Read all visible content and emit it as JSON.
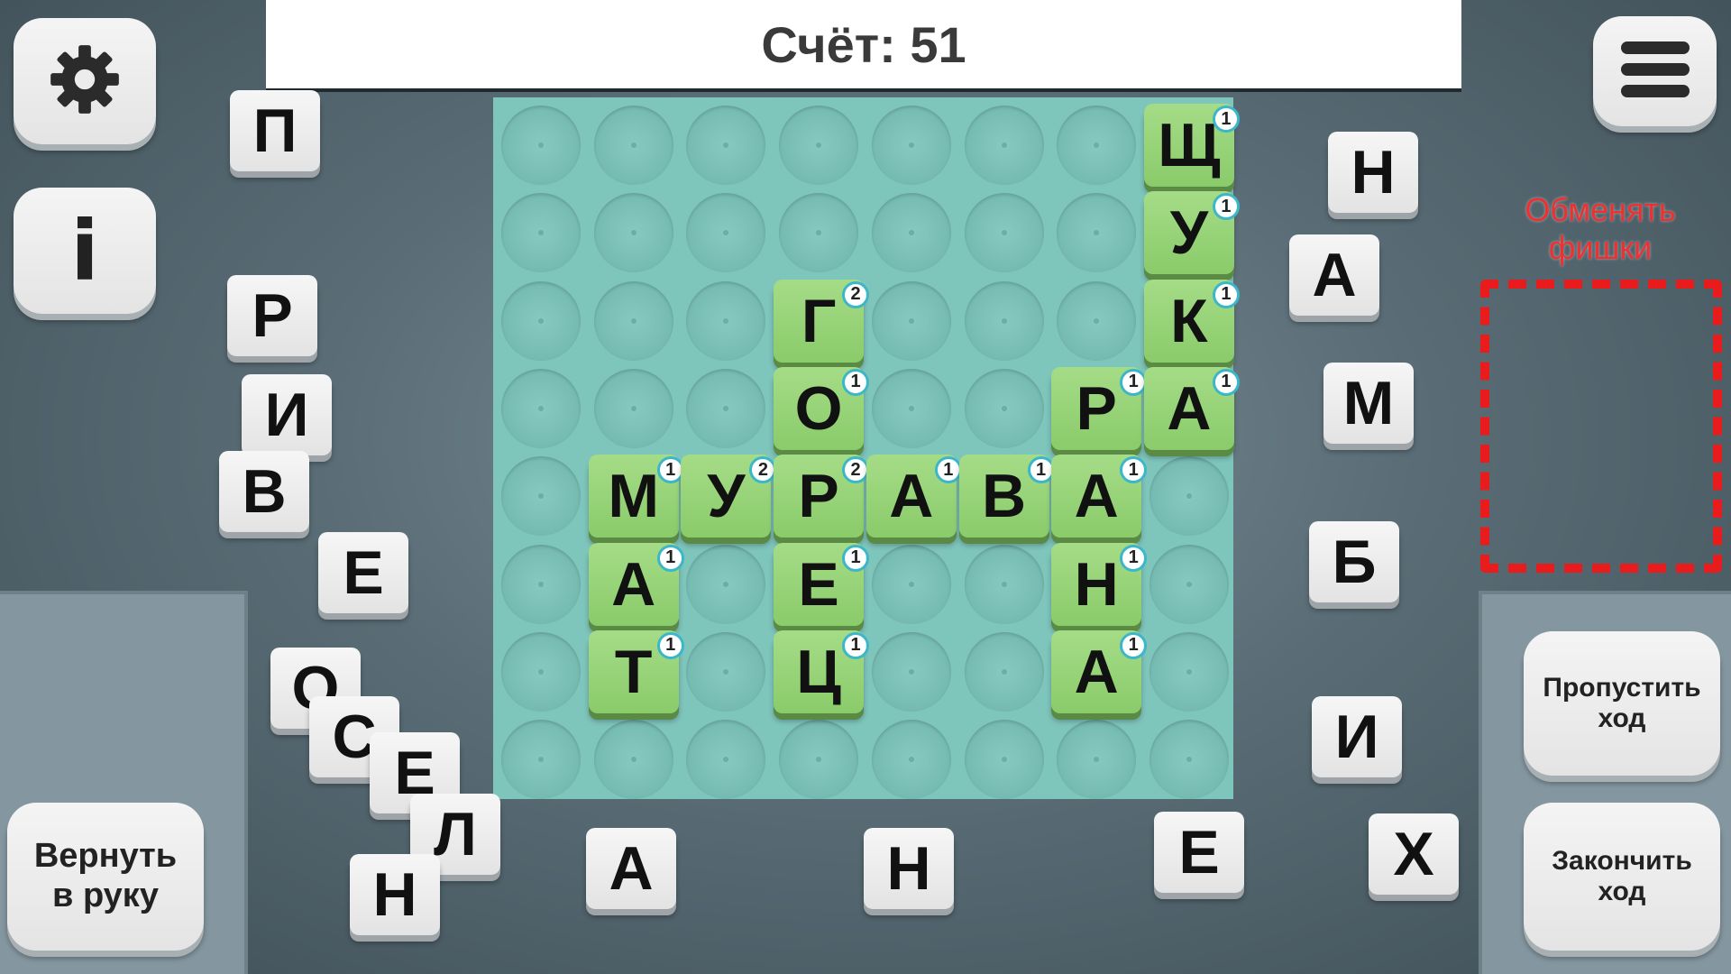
{
  "score": {
    "label": "Счёт: 51"
  },
  "buttons": {
    "settings": "gear-icon",
    "info": "i",
    "menu": "hamburger-icon",
    "return_to_hand": "Вернуть\nв руку",
    "skip_turn": "Пропустить\nход",
    "end_turn": "Закончить\nход"
  },
  "exchange": {
    "label": "Обменять\nфишки"
  },
  "board": {
    "cols": 8,
    "rows": 8,
    "tiles": [
      {
        "r": 0,
        "c": 7,
        "letter": "Щ",
        "points": "1"
      },
      {
        "r": 1,
        "c": 7,
        "letter": "У",
        "points": "1"
      },
      {
        "r": 2,
        "c": 3,
        "letter": "Г",
        "points": "2"
      },
      {
        "r": 2,
        "c": 7,
        "letter": "К",
        "points": "1"
      },
      {
        "r": 3,
        "c": 3,
        "letter": "О",
        "points": "1"
      },
      {
        "r": 3,
        "c": 6,
        "letter": "Р",
        "points": "1"
      },
      {
        "r": 3,
        "c": 7,
        "letter": "А",
        "points": "1"
      },
      {
        "r": 4,
        "c": 1,
        "letter": "М",
        "points": "1"
      },
      {
        "r": 4,
        "c": 2,
        "letter": "У",
        "points": "2"
      },
      {
        "r": 4,
        "c": 3,
        "letter": "Р",
        "points": "2"
      },
      {
        "r": 4,
        "c": 4,
        "letter": "А",
        "points": "1"
      },
      {
        "r": 4,
        "c": 5,
        "letter": "В",
        "points": "1"
      },
      {
        "r": 4,
        "c": 6,
        "letter": "А",
        "points": "1"
      },
      {
        "r": 5,
        "c": 1,
        "letter": "А",
        "points": "1"
      },
      {
        "r": 5,
        "c": 3,
        "letter": "Е",
        "points": "1"
      },
      {
        "r": 5,
        "c": 6,
        "letter": "Н",
        "points": "1"
      },
      {
        "r": 6,
        "c": 1,
        "letter": "Т",
        "points": "1"
      },
      {
        "r": 6,
        "c": 3,
        "letter": "Ц",
        "points": "1"
      },
      {
        "r": 6,
        "c": 6,
        "letter": "А",
        "points": "1"
      }
    ]
  },
  "hand_tiles": [
    "П",
    "Р",
    "И",
    "В",
    "Е",
    "О",
    "С",
    "Е",
    "Л",
    "Н",
    "А",
    "Н",
    "Е",
    "Х",
    "Н",
    "А",
    "М",
    "Б",
    "И"
  ]
}
